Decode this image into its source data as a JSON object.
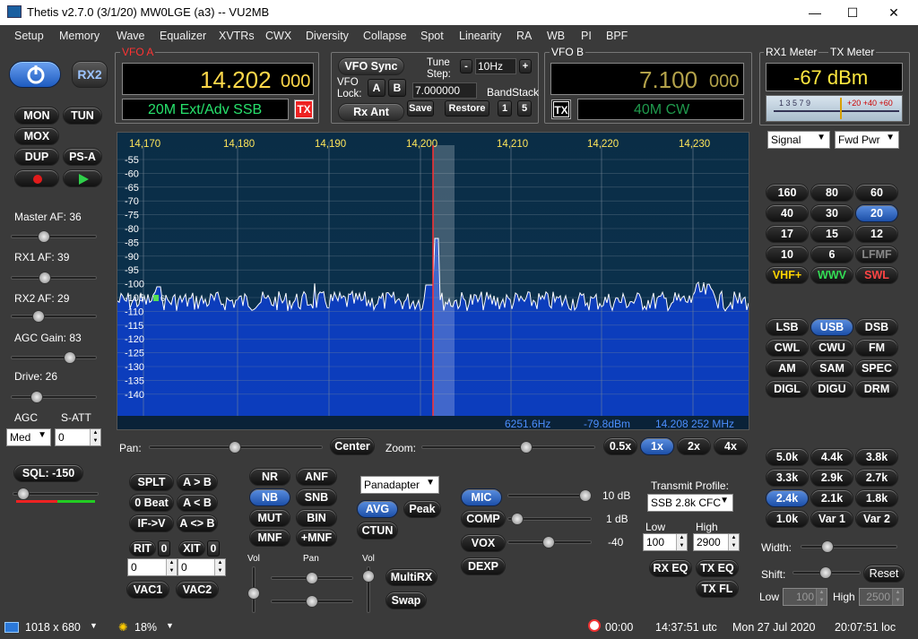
{
  "window": {
    "title": "Thetis v2.7.0 (3/1/20) MW0LGE (a3)   --   VU2MB",
    "minimize": "—",
    "maximize": "☐",
    "close": "✕"
  },
  "menu": [
    "Setup",
    "Memory",
    "Wave",
    "Equalizer",
    "XVTRs",
    "CWX",
    "Diversity",
    "Collapse",
    "Spot",
    "Linearity",
    "RA",
    "WB",
    "PI",
    "BPF"
  ],
  "left": {
    "power_icon": "power-icon",
    "rx2": "RX2",
    "mon": "MON",
    "tun": "TUN",
    "mox": "MOX",
    "dup": "DUP",
    "psa": "PS-A",
    "master_af": "Master AF:  36",
    "rx1_af": "RX1 AF:  39",
    "rx2_af": "RX2 AF:  29",
    "agc_gain": "AGC Gain:  83",
    "drive": "Drive:  26",
    "agc_label": "AGC",
    "satt_label": "S-ATT",
    "agc_value": "Med",
    "satt_value": "0",
    "sql": "SQL: -150",
    "levels": {
      "master_af": 36,
      "rx1_af": 39,
      "rx2_af": 29,
      "agc_gain": 83,
      "drive": 26
    }
  },
  "vfoa": {
    "legend": "VFO A",
    "freq_main": "14.202",
    "freq_sub": "000",
    "mode": "20M Ext/Adv SSB",
    "tx": "TX"
  },
  "vfo_center": {
    "vfo_sync": "VFO Sync",
    "tune_step_label": "Tune Step:",
    "minus": "-",
    "step": "10Hz",
    "plus": "+",
    "vfo_lock": "VFO Lock:",
    "a": "A",
    "b": "B",
    "freq_input": "7.000000",
    "bandstack": "BandStack",
    "rx_ant": "Rx Ant",
    "save": "Save",
    "restore": "Restore",
    "bs1": "1",
    "bs5": "5"
  },
  "vfob": {
    "legend": "VFO B",
    "freq_main": "7.100",
    "freq_sub": "000",
    "mode": "40M CW",
    "tx": "TX"
  },
  "meter": {
    "rx1": "RX1 Meter",
    "tx": "TX Meter",
    "value": "-67 dBm",
    "scale_left": "1  3  5  7  9",
    "scale_right": "+20  +40  +60",
    "rx_select": "Signal",
    "tx_select": "Fwd Pwr"
  },
  "bands": [
    "160",
    "80",
    "60",
    "40",
    "30",
    "20",
    "17",
    "15",
    "12",
    "10",
    "6",
    "LFMF",
    "VHF+",
    "WWV",
    "SWL"
  ],
  "active_band": "20",
  "modes": [
    "LSB",
    "USB",
    "DSB",
    "CWL",
    "CWU",
    "FM",
    "AM",
    "SAM",
    "SPEC",
    "DIGL",
    "DIGU",
    "DRM"
  ],
  "active_mode": "USB",
  "filters": [
    "5.0k",
    "4.4k",
    "3.8k",
    "3.3k",
    "2.9k",
    "2.7k",
    "2.4k",
    "2.1k",
    "1.8k",
    "1.0k",
    "Var 1",
    "Var 2"
  ],
  "active_filter": "2.4k",
  "filter_ctrl": {
    "width": "Width:",
    "shift": "Shift:",
    "reset": "Reset",
    "low": "Low",
    "low_val": "100",
    "high": "High",
    "high_val": "2500"
  },
  "panadapter": {
    "freq_ticks": [
      "14,170",
      "14,180",
      "14,190",
      "14,200",
      "14,210",
      "14,220",
      "14,230"
    ],
    "db_ticks": [
      "-55",
      "-60",
      "-65",
      "-70",
      "-75",
      "-80",
      "-85",
      "-90",
      "-95",
      "-100",
      "-105",
      "-110",
      "-115",
      "-120",
      "-125",
      "-130",
      "-135",
      "-140"
    ],
    "readout_hz": "6251.6Hz",
    "readout_dbm": "-79.8dBm",
    "readout_mhz": "14.208 252 MHz",
    "marker": "6"
  },
  "pan_zoom": {
    "pan": "Pan:",
    "center": "Center",
    "zoom": "Zoom:",
    "z05": "0.5x",
    "z1": "1x",
    "z2": "2x",
    "z4": "4x"
  },
  "bottom": {
    "splt": "SPLT",
    "atob": "A > B",
    "zerobeat": "0 Beat",
    "btoa": "A < B",
    "ifv": "IF->V",
    "aswapb": "A <> B",
    "rit": "RIT",
    "rit_n": "0",
    "xit": "XIT",
    "xit_n": "0",
    "rit_val": "0",
    "xit_val": "0",
    "vac1": "VAC1",
    "vac2": "VAC2",
    "nr": "NR",
    "anf": "ANF",
    "nb": "NB",
    "snb": "SNB",
    "mut": "MUT",
    "bin": "BIN",
    "mnf": "MNF",
    "pmnf": "+MNF",
    "vol": "Vol",
    "pan": "Pan",
    "vol2": "Vol",
    "multirx": "MultiRX",
    "swap": "Swap",
    "display": "Panadapter",
    "avg": "AVG",
    "peak": "Peak",
    "ctun": "CTUN",
    "mic": "MIC",
    "mic_val": "10 dB",
    "comp": "COMP",
    "comp_val": "1 dB",
    "vox": "VOX",
    "vox_val": "-40",
    "dexp": "DEXP",
    "tx_profile": "Transmit Profile:",
    "profile": "SSB 2.8k CFC",
    "low": "Low",
    "high": "High",
    "low_val": "100",
    "high_val": "2900",
    "rxeq": "RX EQ",
    "txeq": "TX EQ",
    "txfl": "TX FL"
  },
  "status": {
    "resolution": "1018 x 680",
    "cpu": "18%",
    "timer": "00:00",
    "utc": "14:37:51 utc",
    "date": "Mon 27 Jul 2020",
    "loc": "20:07:51 loc"
  },
  "colors": {
    "freq_active": "#ffd84a",
    "freq_inactive": "#b3a24a",
    "mode_green": "#27e26c",
    "mode_dim": "#1f9a4c",
    "meter_yellow": "#ffe840",
    "blue": "#2f6bd1",
    "vhf": "#ffd400",
    "wwv": "#33dd55",
    "swl": "#ff4444"
  }
}
